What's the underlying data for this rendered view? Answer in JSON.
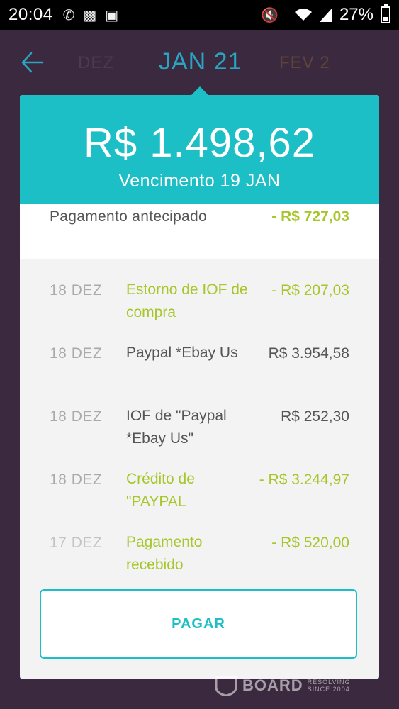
{
  "status_bar": {
    "time": "20:04",
    "battery": "27%",
    "icons": [
      "whatsapp-icon",
      "deezer-icon",
      "image-icon",
      "mute-icon",
      "wifi-icon",
      "signal-icon",
      "battery-icon"
    ]
  },
  "nav": {
    "prev_month": "DEZ",
    "current_month": "JAN 21",
    "next_month": "FEV 2"
  },
  "bill": {
    "amount": "R$ 1.498,62",
    "due": "Vencimento 19 JAN"
  },
  "summary": {
    "label": "Pagamento antecipado",
    "value": "- R$ 727,03"
  },
  "transactions": [
    {
      "date": "18 DEZ",
      "desc": "Estorno de IOF de compra",
      "value": "- R$ 207,03"
    },
    {
      "date": "18 DEZ",
      "desc": "Paypal *Ebay Us",
      "value": "R$ 3.954,58"
    },
    {
      "date": "18 DEZ",
      "desc": "IOF de \"Paypal *Ebay Us\"",
      "value": "R$ 252,30"
    },
    {
      "date": "18 DEZ",
      "desc": "Crédito de \"PAYPAL",
      "value": "- R$ 3.244,97"
    },
    {
      "date": "17 DEZ",
      "desc": "Pagamento recebido",
      "value": "- R$ 520,00"
    }
  ],
  "actions": {
    "pay_label": "PAGAR"
  },
  "watermark": {
    "main": "BOARD",
    "sub1": "RESOLVING",
    "sub2": "SINCE 2004"
  },
  "colors": {
    "accent": "#1cbfc5",
    "credit": "#a6c62a",
    "background": "#3b2a3f"
  }
}
